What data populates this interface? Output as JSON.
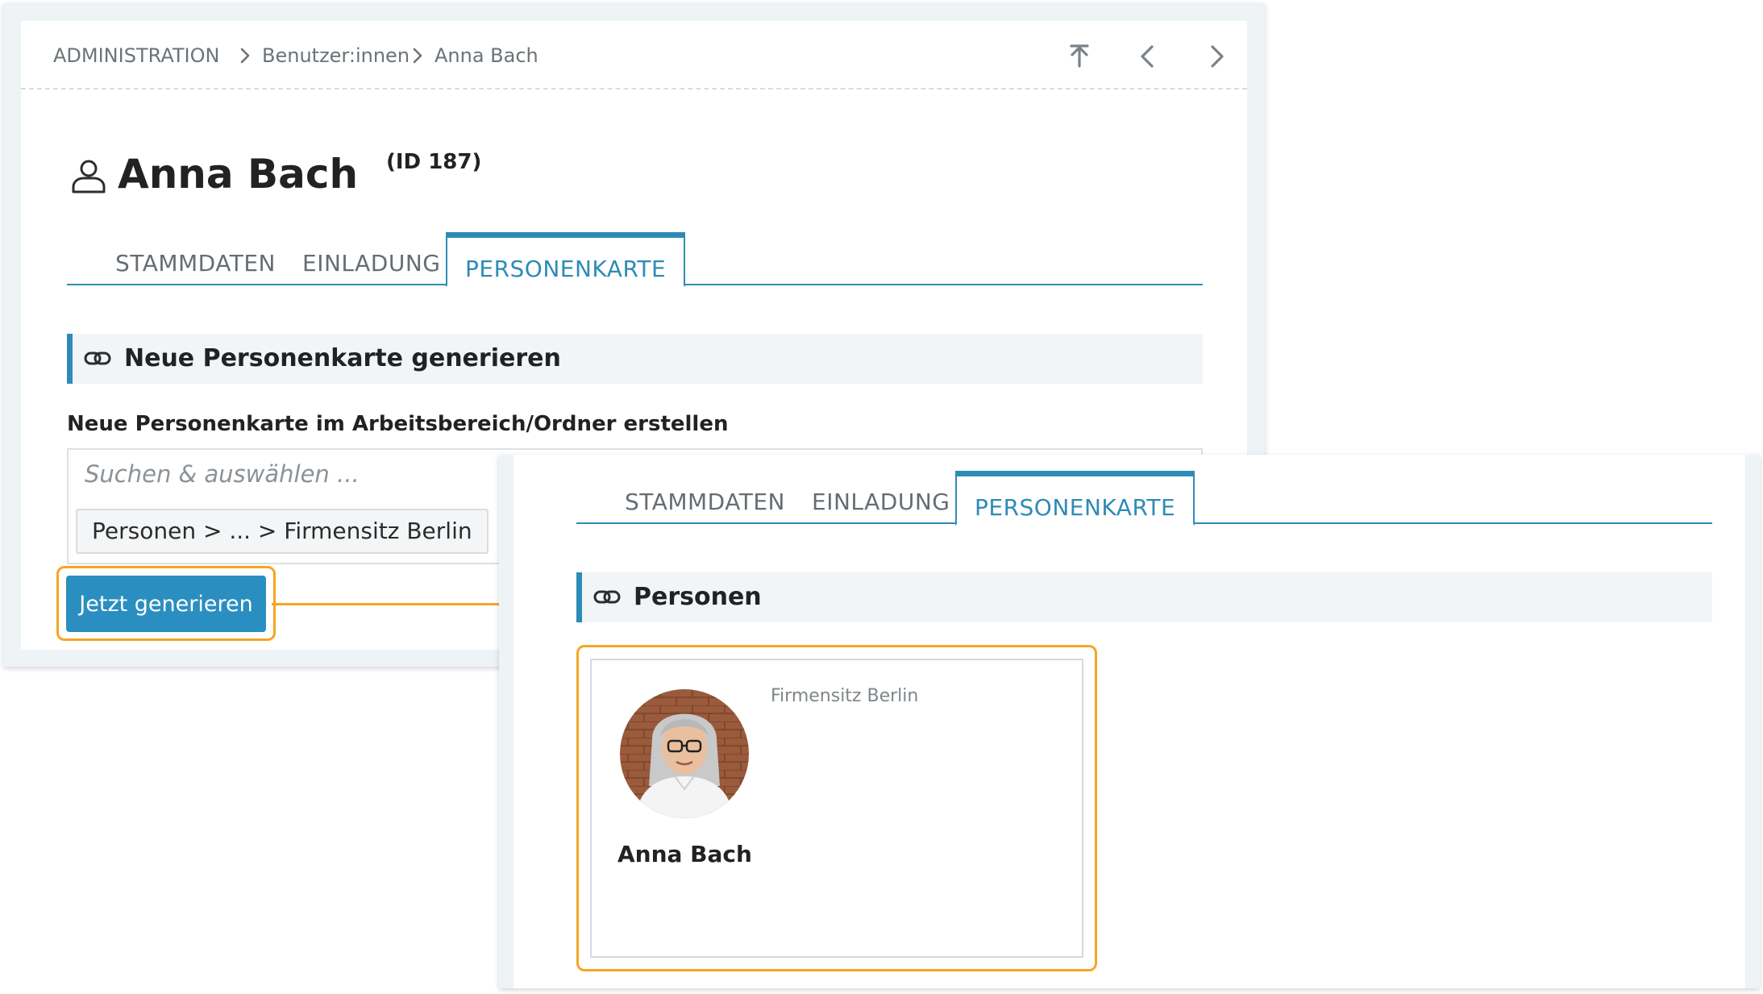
{
  "breadcrumb": {
    "items": [
      "ADMINISTRATION",
      "Benutzer:innen",
      "Anna Bach"
    ]
  },
  "header": {
    "title": "Anna Bach",
    "id_label": "(ID 187)"
  },
  "tabs": [
    {
      "label": "STAMMDATEN",
      "active": false
    },
    {
      "label": "EINLADUNG",
      "active": false
    },
    {
      "label": "PERSONENKARTE",
      "active": true
    }
  ],
  "generate_section": {
    "title": "Neue Personenkarte generieren",
    "field_label": "Neue Personenkarte im Arbeitsbereich/Ordner erstellen",
    "search_placeholder": "Suchen & auswählen ...",
    "selected_folder": "Personen > ... > Firmensitz Berlin",
    "button_label": "Jetzt generieren"
  },
  "result_section": {
    "title": "Personen",
    "card": {
      "location": "Firmensitz Berlin",
      "name": "Anna Bach"
    }
  },
  "colors": {
    "accent": "#2e8bb7",
    "button": "#2b8ec0",
    "highlight": "#f5a623",
    "panel_bg": "#eef3f6",
    "section_bg": "#f1f5f7"
  },
  "icons": [
    "chevron-right-icon",
    "up-arrow-icon",
    "chevron-left-icon",
    "user-icon",
    "link-icon"
  ]
}
